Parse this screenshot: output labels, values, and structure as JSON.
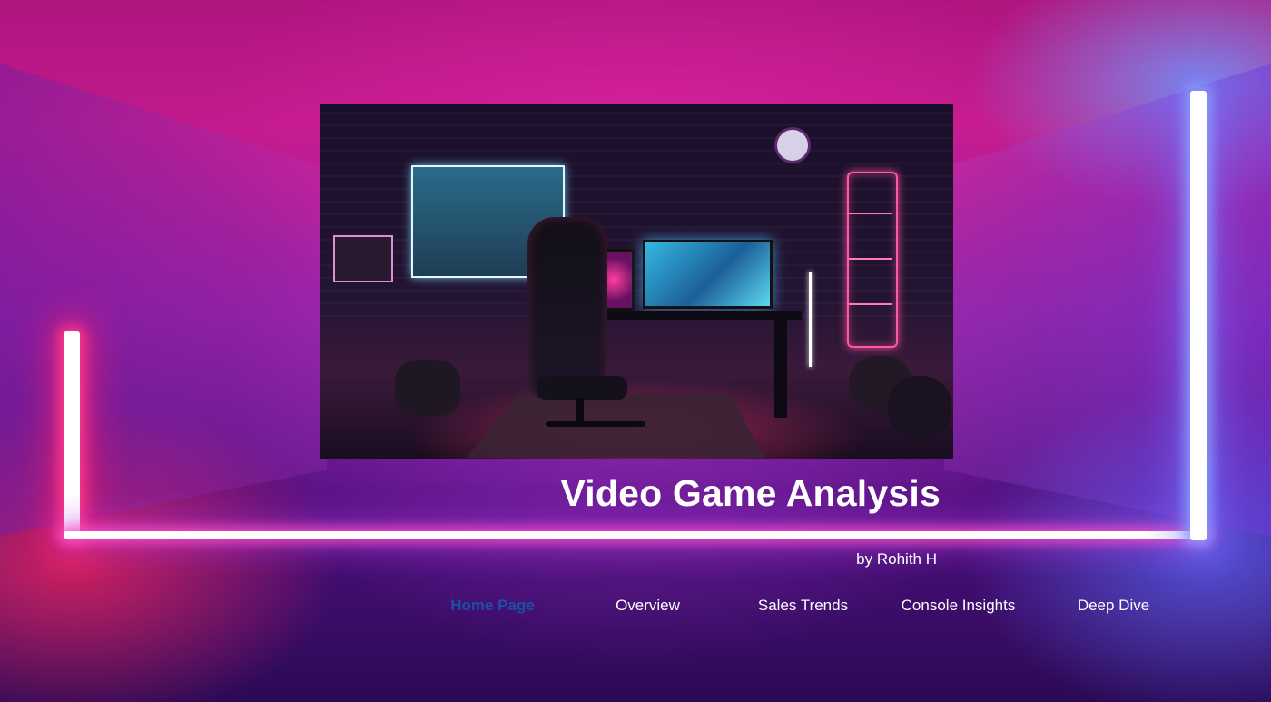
{
  "report": {
    "title": "Video Game Analysis",
    "byline": "by Rohith H"
  },
  "hero_image": {
    "description_icon": "gaming-room-image"
  },
  "nav": {
    "active_index": 0,
    "items": [
      {
        "label": "Home Page"
      },
      {
        "label": "Overview"
      },
      {
        "label": "Sales Trends"
      },
      {
        "label": "Console Insights"
      },
      {
        "label": "Deep Dive"
      }
    ]
  },
  "colors": {
    "active_nav": "#1a4fa8",
    "text": "#ffffff",
    "neon_pink": "#ff3c8c",
    "neon_blue": "#8ca0ff"
  }
}
